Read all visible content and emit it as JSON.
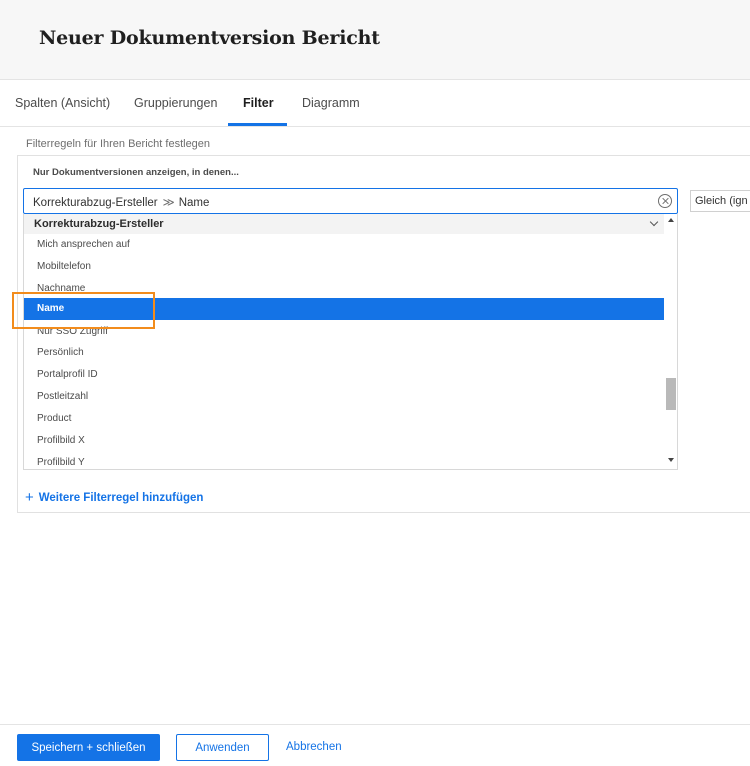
{
  "header": {
    "title": "Neuer Dokumentversion Bericht"
  },
  "tabs": [
    {
      "label": "Spalten (Ansicht)"
    },
    {
      "label": "Gruppierungen"
    },
    {
      "label": "Filter"
    },
    {
      "label": "Diagramm"
    }
  ],
  "active_tab": "Filter",
  "filter": {
    "hint": "Filterregeln für Ihren Bericht festlegen",
    "subhint": "Nur Dokumentversionen anzeigen, in denen...",
    "field": {
      "path": "Korrekturabzug-Ersteller",
      "separator": "≫",
      "value": "Name"
    },
    "operator": "Gleich (ign",
    "dropdown": {
      "group": "Korrekturabzug-Ersteller",
      "items": [
        {
          "label": "Mich ansprechen auf"
        },
        {
          "label": "Mobiltelefon"
        },
        {
          "label": "Nachname"
        },
        {
          "label": "Name",
          "selected": true
        },
        {
          "label": "Nur SSO Zugriff"
        },
        {
          "label": "Persönlich"
        },
        {
          "label": "Portalprofil ID"
        },
        {
          "label": "Postleitzahl"
        },
        {
          "label": "Product"
        },
        {
          "label": "Profilbild X"
        },
        {
          "label": "Profilbild Y"
        }
      ]
    },
    "add_rule": "Weitere Filterregel hinzufügen"
  },
  "footer": {
    "save_close": "Speichern + schließen",
    "apply": "Anwenden",
    "cancel": "Abbrechen"
  },
  "colors": {
    "accent": "#1473e6",
    "highlight": "#f28c1c"
  }
}
